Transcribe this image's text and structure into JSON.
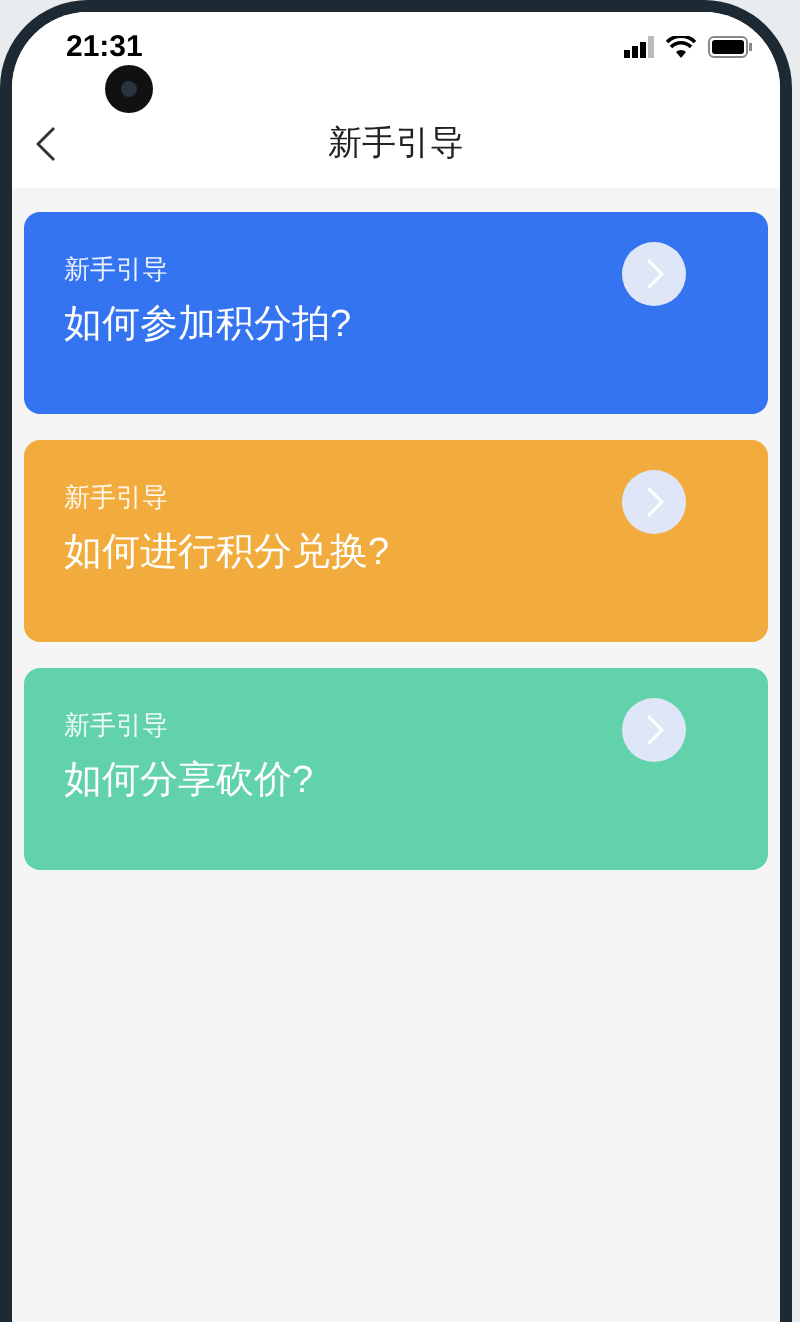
{
  "status_bar": {
    "time": "21:31"
  },
  "nav_bar": {
    "title": "新手引导"
  },
  "cards": [
    {
      "label": "新手引导",
      "question": "如何参加积分拍?",
      "color": "#3574f0"
    },
    {
      "label": "新手引导",
      "question": "如何进行积分兑换?",
      "color": "#f2ac3e"
    },
    {
      "label": "新手引导",
      "question": "如何分享砍价?",
      "color": "#62d2ab"
    }
  ]
}
